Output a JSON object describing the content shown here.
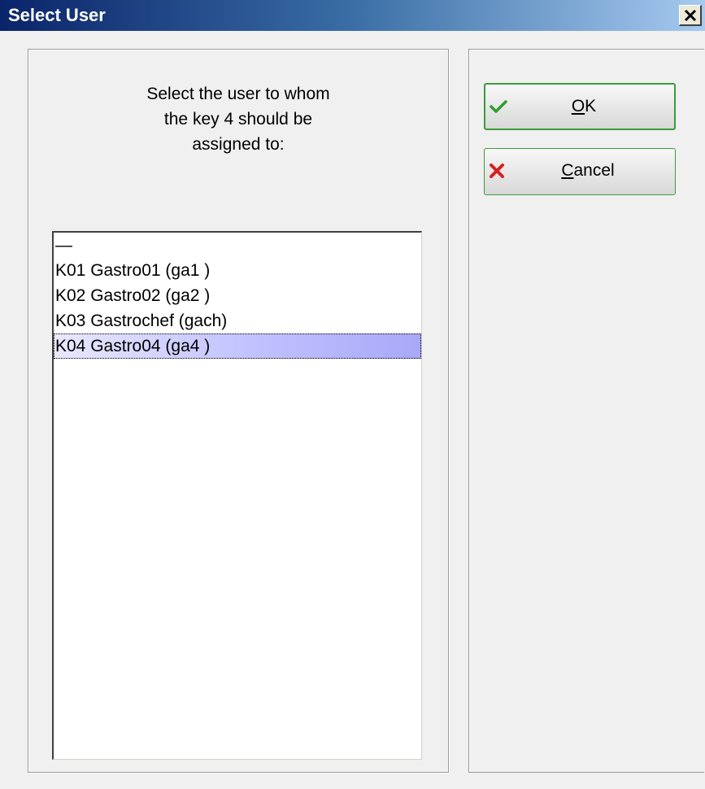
{
  "window": {
    "title": "Select User",
    "close_glyph": "×"
  },
  "instruction": {
    "line1": "Select the user to whom",
    "line2": "the key 4 should be",
    "line3": "assigned to:"
  },
  "user_list": {
    "items": [
      "—",
      "K01 Gastro01 (ga1 )",
      "K02 Gastro02 (ga2 )",
      "K03 Gastrochef (gach)",
      "K04 Gastro04 (ga4 )"
    ],
    "selected_index": 4
  },
  "buttons": {
    "ok_label": "OK",
    "ok_icon": "checkmark-icon",
    "cancel_label": "Cancel",
    "cancel_icon": "x-icon"
  },
  "colors": {
    "title_start": "#0a246a",
    "title_end": "#a6caf0",
    "selection": "#c4c4ff",
    "button_border": "#3c9b3c",
    "check": "#2e9e2e",
    "cancel_x": "#d62020"
  }
}
